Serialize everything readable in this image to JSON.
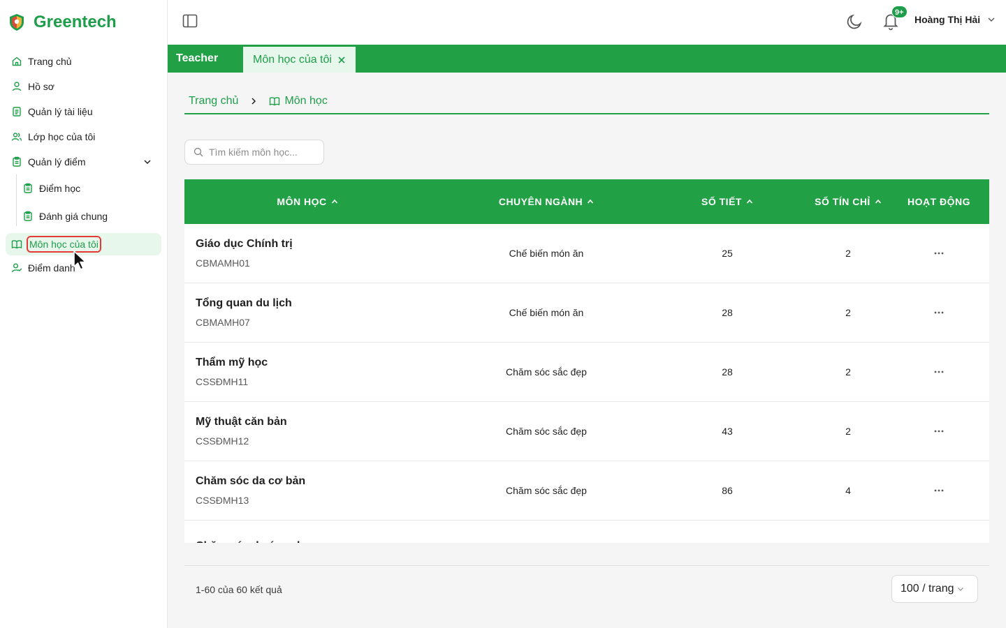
{
  "app": {
    "brand": "Greentech"
  },
  "sidebar": {
    "items": [
      {
        "label": "Trang chủ",
        "icon": "home-icon"
      },
      {
        "label": "Hồ sơ",
        "icon": "user-icon"
      },
      {
        "label": "Quản lý tài liệu",
        "icon": "document-icon"
      },
      {
        "label": "Lớp học của tôi",
        "icon": "users-icon"
      },
      {
        "label": "Quản lý điểm",
        "icon": "clipboard-icon",
        "expanded": true
      },
      {
        "label": "Môn học của tôi",
        "icon": "book-icon",
        "active": true
      },
      {
        "label": "Điểm danh",
        "icon": "user-check-icon"
      }
    ],
    "grade_sub": [
      {
        "label": "Điểm học"
      },
      {
        "label": "Đánh giá chung"
      }
    ]
  },
  "header": {
    "notifications_badge": "9+",
    "user_name": "Hoàng Thị Hải"
  },
  "tabs": [
    {
      "label": "Teacher"
    },
    {
      "label": "Môn học của tôi",
      "active": true
    }
  ],
  "breadcrumb": [
    "Trang chủ",
    "Môn học"
  ],
  "search": {
    "placeholder": "Tìm kiếm môn học..."
  },
  "table": {
    "columns": [
      "MÔN HỌC",
      "CHUYÊN NGÀNH",
      "SỐ TIẾT",
      "SỐ TÍN CHỈ",
      "HOẠT ĐỘNG"
    ],
    "rows": [
      {
        "name": "Giáo dục Chính trị",
        "code": "CBMAMH01",
        "major": "Chế biến món ăn",
        "periods": "25",
        "credits": "2"
      },
      {
        "name": "Tổng quan du lịch",
        "code": "CBMAMH07",
        "major": "Chế biến món ăn",
        "periods": "28",
        "credits": "2"
      },
      {
        "name": "Thẩm mỹ học",
        "code": "CSSĐMH11",
        "major": "Chăm sóc sắc đẹp",
        "periods": "28",
        "credits": "2"
      },
      {
        "name": "Mỹ thuật căn bản",
        "code": "CSSĐMH12",
        "major": "Chăm sóc sắc đẹp",
        "periods": "43",
        "credits": "2"
      },
      {
        "name": "Chăm sóc da cơ bản",
        "code": "CSSĐMH13",
        "major": "Chăm sóc sắc đẹp",
        "periods": "86",
        "credits": "4"
      },
      {
        "name": "Chăm sóc da ứng dụng",
        "code": "",
        "major": "",
        "periods": "",
        "credits": ""
      }
    ]
  },
  "footer": {
    "count_text": "1-60 của 60 kết quả",
    "page_size": "100 / trang"
  },
  "colors": {
    "primary": "#22a045",
    "active_bg": "#e8f7ec",
    "highlight": "#e53935"
  }
}
